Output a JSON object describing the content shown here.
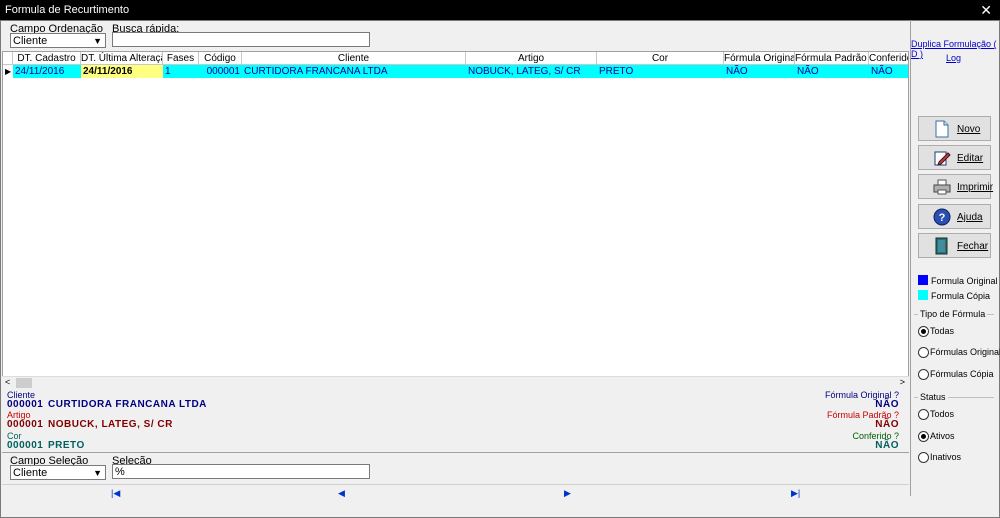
{
  "window": {
    "title": "Formula de Recurtimento",
    "close_glyph": "✕"
  },
  "filters": {
    "order_label": "Campo Ordenação",
    "order_value": "Cliente",
    "quick_search_label": "Busca rápida:",
    "quick_search_value": ""
  },
  "grid": {
    "columns": [
      "DT. Cadastro",
      "DT. Última Alteração",
      "Fases",
      "Código",
      "Cliente",
      "Artigo",
      "Cor",
      "Fórmula Original ?",
      "Fórmula Padrão ?",
      "Conferido ?"
    ],
    "rows": [
      {
        "dt_cadastro": "24/11/2016",
        "dt_ultima": "24/11/2016",
        "fases": "1",
        "codigo": "000001",
        "cliente": "CURTIDORA FRANCANA LTDA",
        "artigo": "NOBUCK, LATEG, S/ CR",
        "cor": "PRETO",
        "formula_original": "NÃO",
        "formula_padrao": "NÃO",
        "conferido": "NÃO"
      }
    ]
  },
  "detail": {
    "cliente_label": "Cliente",
    "cliente_code": "000001",
    "cliente_name": "CURTIDORA FRANCANA LTDA",
    "artigo_label": "Artigo",
    "artigo_code": "000001",
    "artigo_name": "NOBUCK, LATEG, S/ CR",
    "cor_label": "Cor",
    "cor_code": "000001",
    "cor_name": "PRETO",
    "formula_original_label": "Fórmula Original ?",
    "formula_original_value": "NÃO",
    "formula_padrao_label": "Fórmula Padrão ?",
    "formula_padrao_value": "NÃO",
    "conferido_label": "Conferido ?",
    "conferido_value": "NÃO"
  },
  "selection": {
    "field_label": "Campo Seleção",
    "field_value": "Cliente",
    "selection_label": "Seleção",
    "selection_value": "%"
  },
  "sidebar": {
    "link_duplicate": "Duplica Formulação ( D )",
    "link_log": "Log",
    "buttons": {
      "novo": "Novo",
      "editar": "Editar",
      "imprimir": "Imprimir",
      "ajuda": "Ajuda",
      "fechar": "Fechar"
    },
    "legend": [
      {
        "label": "Formula Original",
        "color": "#0000ff"
      },
      {
        "label": "Formula Cópia",
        "color": "#00ffff"
      }
    ],
    "tipo_title": "Tipo de Fórmula",
    "tipo_options": [
      "Todas",
      "Fórmulas Original",
      "Fórmulas Cópia"
    ],
    "tipo_selected": "Todas",
    "status_title": "Status",
    "status_options": [
      "Todos",
      "Ativos",
      "Inativos"
    ],
    "status_selected": "Ativos"
  },
  "colors": {
    "row_copy": "#00ffff",
    "row_edit_cell": "#ffff80",
    "detail_blue": "#000080",
    "detail_red": "#800000",
    "detail_green": "#006060"
  }
}
